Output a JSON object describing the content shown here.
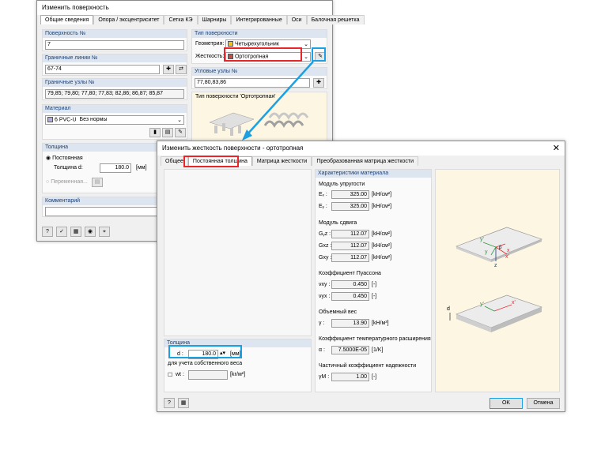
{
  "back_dialog": {
    "title": "Изменить поверхность",
    "tabs": [
      "Общие сведения",
      "Опора / эксцентриситет",
      "Сетка КЭ",
      "Шарниры",
      "Интегрированные",
      "Оси",
      "Балочная решетка"
    ],
    "surface_no": {
      "label": "Поверхность №",
      "value": "7"
    },
    "boundary_lines": {
      "label": "Граничные линии №",
      "value": "67-74"
    },
    "boundary_nodes": {
      "label": "Граничные узлы №",
      "value": "79,85; 79,80; 77,80; 77,83; 82,86; 86,87; 85,87"
    },
    "material": {
      "label": "Материал",
      "number": "6",
      "name": "PVC-U",
      "norm": "Без нормы"
    },
    "thickness": {
      "label": "Толщина",
      "constant": "Постоянная",
      "d_label": "Толщина d:",
      "d_value": "180.0",
      "unit": "[мм]",
      "variable": "Переменная..."
    },
    "comment": {
      "label": "Комментарий",
      "value": ""
    },
    "surface_type": {
      "label": "Тип поверхности",
      "geometry_label": "Геометрия:",
      "geometry_value": "Четырехугольник",
      "stiffness_label": "Жесткость:",
      "stiffness_value": "Ортотропная"
    },
    "corner_nodes": {
      "label": "Угловые узлы №",
      "value": "77,80,83,86"
    },
    "preview_label": "Тип поверхности 'Ортотропная'"
  },
  "front_dialog": {
    "title": "Изменить жесткость поверхности - ортотропная",
    "tabs": [
      "Общее",
      "Постоянная толщина",
      "Матрица жесткости",
      "Преобразованная матрица жесткости"
    ],
    "thickness_group": {
      "label": "Толщина",
      "d_label": "d :",
      "d_value": "180.0",
      "d_unit": "[мм]",
      "selfweight_label": "для учета собственного веса",
      "wt_label": "wt :",
      "wt_unit": "[kг/м²]"
    },
    "material_props": {
      "label": "Характеристики материала",
      "elastic": {
        "label": "Модуль упругости",
        "rows": [
          {
            "sym": "Eₓ :",
            "value": "325.00",
            "unit": "[kH/см²]"
          },
          {
            "sym": "Eᵧ :",
            "value": "325.00",
            "unit": "[kH/см²]"
          }
        ]
      },
      "shear": {
        "label": "Модуль сдвига",
        "rows": [
          {
            "sym": "Gᵧz :",
            "value": "112.07",
            "unit": "[kH/см²]"
          },
          {
            "sym": "Gxz :",
            "value": "112.07",
            "unit": "[kH/см²]"
          },
          {
            "sym": "Gxy :",
            "value": "112.07",
            "unit": "[kH/см²]"
          }
        ]
      },
      "poisson": {
        "label": "Коэффициент Пуассона",
        "rows": [
          {
            "sym": "νxy :",
            "value": "0.450",
            "unit": "[-]"
          },
          {
            "sym": "νyx :",
            "value": "0.450",
            "unit": "[-]"
          }
        ]
      },
      "weight": {
        "label": "Объемный вес",
        "sym": "γ :",
        "value": "13.90",
        "unit": "[kH/м³]"
      },
      "thermal": {
        "label": "Коэффициент температурного расширения",
        "sym": "α :",
        "value": "7.5000E-05",
        "unit": "[1/K]"
      },
      "safety": {
        "label": "Частичный коэффициент надежности",
        "sym": "γM :",
        "value": "1.00",
        "unit": "[-]"
      }
    },
    "ok_label": "OK",
    "cancel_label": "Отмена"
  },
  "highlight_colors": {
    "red": "#e8262a",
    "blue": "#1ba1e2"
  }
}
